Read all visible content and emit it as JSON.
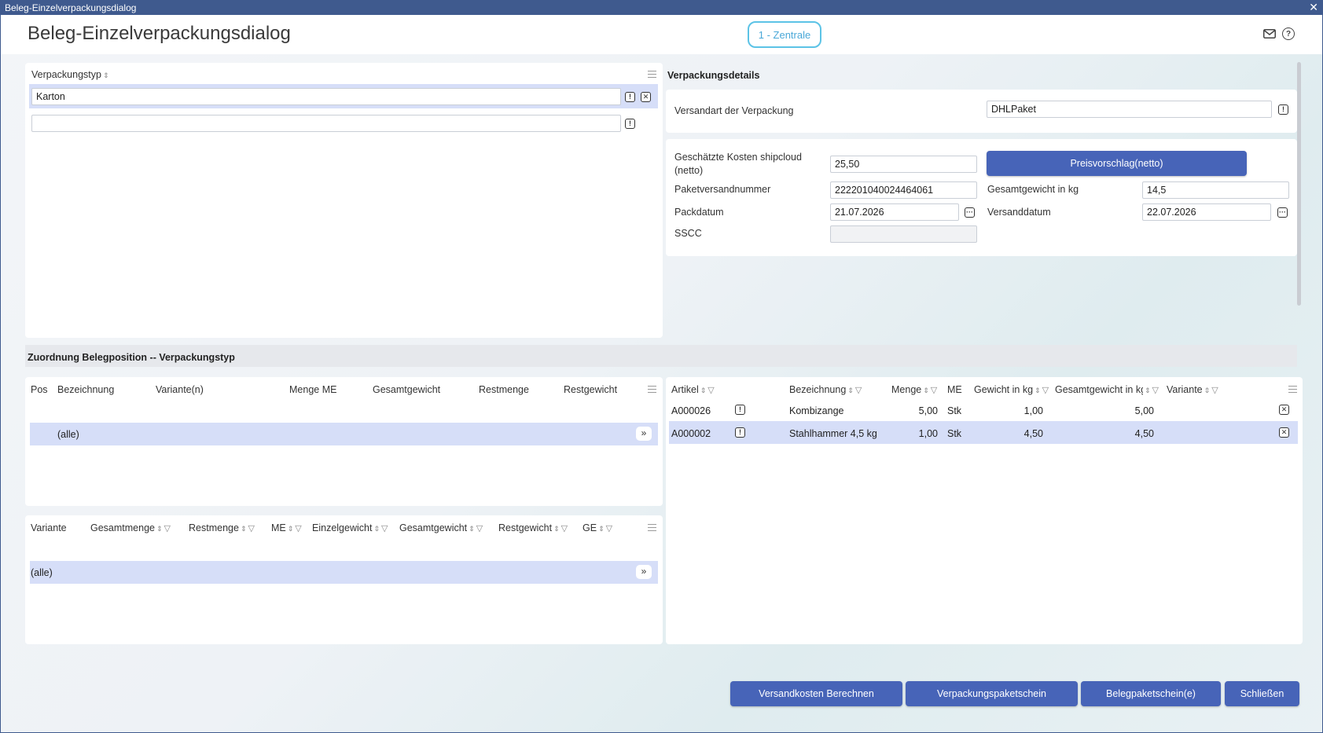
{
  "window": {
    "title": "Beleg-Einzelverpackungsdialog",
    "close_glyph": "✕"
  },
  "header": {
    "title": "Beleg-Einzelverpackungsdialog",
    "location_badge": "1 - Zentrale",
    "icons": [
      "mail-icon",
      "help-icon"
    ]
  },
  "verpackungstyp": {
    "column_header": "Verpackungstyp",
    "rows": [
      {
        "value": "Karton"
      },
      {
        "value": ""
      }
    ]
  },
  "details": {
    "title": "Verpackungsdetails",
    "versandart_label": "Versandart der Verpackung",
    "versandart_value": "DHLPaket",
    "kosten_label": "Geschätzte Kosten shipcloud (netto)",
    "kosten_value": "25,50",
    "preisvorschlag_button": "Preisvorschlag(netto)",
    "paketnummer_label": "Paketversandnummer",
    "paketnummer_value": "222201040024464061",
    "gewicht_label": "Gesamtgewicht in kg",
    "gewicht_value": "14,5",
    "packdatum_label": "Packdatum",
    "packdatum_value": "21.07.2026",
    "versanddatum_label": "Versanddatum",
    "versanddatum_value": "22.07.2026",
    "sscc_label": "SSCC",
    "sscc_value": ""
  },
  "zuordnung": {
    "title": "Zuordnung Belegposition -- Verpackungstyp",
    "positions": {
      "columns": [
        "Pos",
        "Bezeichnung",
        "Variante(n)",
        "Menge ME",
        "Gesamtgewicht",
        "Restmenge",
        "Restgewicht"
      ],
      "rows": [
        {
          "bezeichnung": "(alle)"
        }
      ]
    },
    "varianten": {
      "columns": [
        "Variante",
        "Gesamtmenge",
        "Restmenge",
        "ME",
        "Einzelgewicht",
        "Gesamtgewicht",
        "Restgewicht",
        "GE"
      ],
      "rows": [
        {
          "variante": "(alle)"
        }
      ]
    },
    "artikel": {
      "columns": [
        "Artikel",
        "Bezeichnung",
        "Menge",
        "ME",
        "Gewicht in kg",
        "Gesamtgewicht in kg",
        "Variante"
      ],
      "rows": [
        {
          "artikel": "A000026",
          "bezeichnung": "Kombizange",
          "menge": "5,00",
          "me": "Stk",
          "gewicht": "1,00",
          "gesamtgewicht": "5,00",
          "variante": ""
        },
        {
          "artikel": "A000002",
          "bezeichnung": "Stahlhammer 4,5 kg",
          "menge": "1,00",
          "me": "Stk",
          "gewicht": "4,50",
          "gesamtgewicht": "4,50",
          "variante": ""
        }
      ]
    }
  },
  "footer": {
    "buttons": [
      "Versandkosten Berechnen",
      "Verpackungspaketschein",
      "Belegpaketschein(e)",
      "Schließen"
    ]
  },
  "colors": {
    "accent": "#4764b8",
    "selection": "#d6def8",
    "titlebar": "#3f5a8e",
    "badge": "#5cc3e6"
  }
}
